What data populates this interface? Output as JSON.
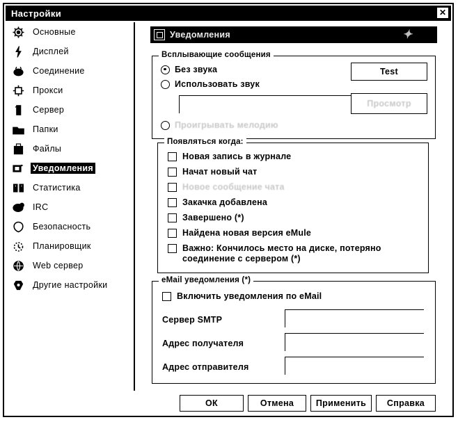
{
  "window": {
    "title": "Настройки",
    "close_label": "✕"
  },
  "sidebar": {
    "items": [
      {
        "label": "Основные",
        "icon": "gear-icon",
        "selected": false
      },
      {
        "label": "Дисплей",
        "icon": "display-icon",
        "selected": false
      },
      {
        "label": "Соединение",
        "icon": "connection-icon",
        "selected": false
      },
      {
        "label": "Прокси",
        "icon": "proxy-icon",
        "selected": false
      },
      {
        "label": "Сервер",
        "icon": "server-icon",
        "selected": false
      },
      {
        "label": "Папки",
        "icon": "folder-icon",
        "selected": false
      },
      {
        "label": "Файлы",
        "icon": "files-icon",
        "selected": false
      },
      {
        "label": "Уведомления",
        "icon": "notify-icon",
        "selected": true
      },
      {
        "label": "Статистика",
        "icon": "stats-icon",
        "selected": false
      },
      {
        "label": "IRC",
        "icon": "irc-icon",
        "selected": false
      },
      {
        "label": "Безопасность",
        "icon": "security-icon",
        "selected": false
      },
      {
        "label": "Планировщик",
        "icon": "scheduler-icon",
        "selected": false
      },
      {
        "label": "Web сервер",
        "icon": "webserver-icon",
        "selected": false
      },
      {
        "label": "Другие настройки",
        "icon": "other-icon",
        "selected": false
      }
    ]
  },
  "panel": {
    "header_title": "Уведомления",
    "popup_group": {
      "title": "Всплывающие сообщения",
      "radios": [
        {
          "label": "Без звука",
          "checked": true,
          "faded": false
        },
        {
          "label": "Использовать звук",
          "checked": false,
          "faded": false
        },
        {
          "label": "Проигрывать мелодию",
          "checked": false,
          "faded": true
        }
      ],
      "sound_path_value": "",
      "sound_path_placeholder": "",
      "test_button": "Test",
      "browse_button": "Просмотр"
    },
    "appear_group": {
      "title": "Появляться когда:",
      "checkboxes": [
        {
          "label": "Новая запись в журнале",
          "checked": false,
          "faded": false
        },
        {
          "label": "Начат новый чат",
          "checked": false,
          "faded": false
        },
        {
          "label": "Новое сообщение чата",
          "checked": false,
          "faded": true
        },
        {
          "label": "Закачка добавлена",
          "checked": false,
          "faded": false
        },
        {
          "label": "Завершено (*)",
          "checked": false,
          "faded": false
        },
        {
          "label": "Найдена новая версия eMule",
          "checked": false,
          "faded": false
        },
        {
          "label": "Важно: Кончилось место на диске, потеряно соединение с сервером (*)",
          "checked": false,
          "faded": false
        }
      ]
    },
    "email_group": {
      "title": "eMail уведомления (*)",
      "enable_checkbox": {
        "label": "Включить уведомления по eMail",
        "checked": false
      },
      "fields": [
        {
          "label": "Сервер SMTP",
          "value": "",
          "placeholder": ""
        },
        {
          "label": "Адрес получателя",
          "value": "",
          "placeholder": ""
        },
        {
          "label": "Адрес отправителя",
          "value": "",
          "placeholder": ""
        }
      ]
    }
  },
  "footer": {
    "ok": "ОК",
    "cancel": "Отмена",
    "apply": "Применить",
    "help": "Справка"
  },
  "colors": {
    "bg": "#ffffff",
    "fg": "#000000",
    "titlebar_bg": "#000000",
    "titlebar_fg": "#ffffff",
    "selected_bg": "#000000",
    "selected_fg": "#ffffff"
  }
}
